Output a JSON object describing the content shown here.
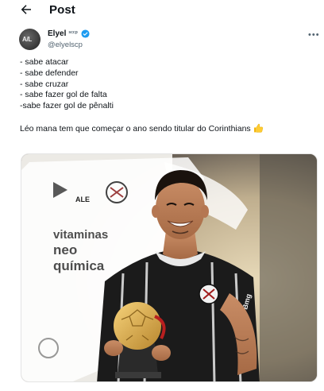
{
  "header": {
    "title": "Post"
  },
  "author": {
    "name": "Elyel",
    "badge": "sccp",
    "handle": "@elyelscp",
    "avatar_text": "A/L"
  },
  "tweet": {
    "lines": [
      "- sabe atacar",
      "- sabe defender",
      "- sabe cruzar",
      "- sabe fazer gol de falta",
      "-sabe fazer gol de pênalti"
    ],
    "closing": "Léo mana tem que começar o ano sendo titular do Corinthians",
    "emoji": "thumbs-up"
  },
  "media": {
    "jersey_brand_1": "vitaminas",
    "jersey_brand_2": "neo",
    "jersey_brand_3": "química",
    "sponsor_small": "ALE",
    "sleeve_text": "Bmg"
  },
  "colors": {
    "accent": "#1d9bf0",
    "text": "#0f1419",
    "secondary_text": "#536471"
  }
}
